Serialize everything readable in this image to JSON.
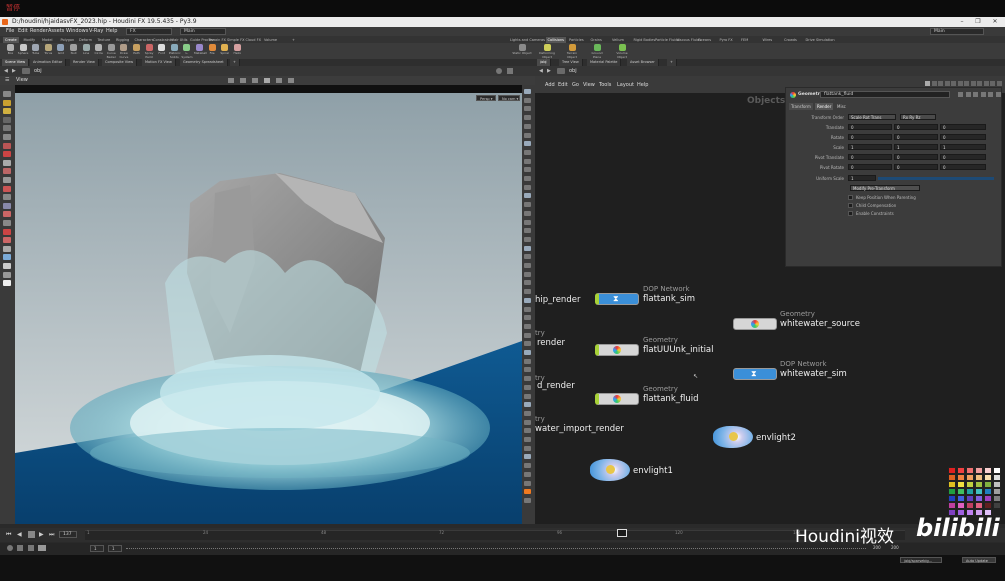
{
  "top_banner": "暂停",
  "window": {
    "title": "D:/houdini/hjaidasvFX_2023.hip - Houdini FX 19.5.435 - Py3.9",
    "controls": [
      "–",
      "❐",
      "✕"
    ]
  },
  "menubar": {
    "items": [
      "File",
      "Edit",
      "Render",
      "Assets",
      "Windows",
      "V-Ray",
      "Help"
    ],
    "fx_field": "FX",
    "main_field": "Main",
    "right_field": "Main"
  },
  "shelf_tabs_left": [
    "Create",
    "Modify",
    "Model",
    "Polygon",
    "Deform",
    "Texture",
    "Rigging",
    "Characters",
    "Constraints",
    "Hair Utils",
    "Guide Process",
    "Terrain FX",
    "Simple FX",
    "Cloud FX",
    "Volume"
  ],
  "shelf_tabs_right": [
    "Lights and Cameras",
    "Collisions",
    "Particles",
    "Grains",
    "Vellum",
    "Rigid Bodies",
    "Particle Fluids",
    "Viscous Fluids",
    "Oceans",
    "Pyro FX",
    "FEM",
    "Wires",
    "Crowds",
    "Drive Simulation"
  ],
  "shelf_tools_left": [
    "Box",
    "Sphere",
    "Tube",
    "Torus",
    "Grid",
    "Null",
    "Line",
    "Circle",
    "Curve Bezier",
    "Draw Curve",
    "Path",
    "Spray Paint",
    "Font",
    "Platonic Solids",
    "L-System",
    "Metaball",
    "File",
    "Spiral",
    "Helix"
  ],
  "shelf_tools_right": [
    "Static Object",
    "Deforming Object",
    "Terrain Object",
    "Ground Plane",
    "Volume Object"
  ],
  "panel_tabs_left": [
    "Scene View",
    "Animation Editor",
    "Render View",
    "Composite View",
    "Motion FX View",
    "Geometry Spreadsheet"
  ],
  "panel_tabs_right": [
    "/obj",
    "Tree View",
    "Material Palette",
    "Asset Browser"
  ],
  "path_left": "obj",
  "path_right": "obj",
  "viewport": {
    "label": "View",
    "persp_button": "Persp ▾",
    "cam_button": "No cam ▾"
  },
  "network": {
    "menu": [
      "Add",
      "Edit",
      "Go",
      "View",
      "Tools",
      "Layout",
      "Help"
    ],
    "context_label": "Objects",
    "nodes": [
      {
        "name": "flattank_sim",
        "type": "DOP Network",
        "kind": "dop",
        "flag": "green"
      },
      {
        "name": "flatUUUnk_initial",
        "type": "Geometry",
        "kind": "geo",
        "flag": "green"
      },
      {
        "name": "flattank_fluid",
        "type": "Geometry",
        "kind": "geo",
        "flag": "green"
      },
      {
        "name": "whitewater_source",
        "type": "Geometry",
        "kind": "geo",
        "flag": "none"
      },
      {
        "name": "whitewater_sim",
        "type": "DOP Network",
        "kind": "dop",
        "flag": "none"
      },
      {
        "name": "envlight2",
        "type": "",
        "kind": "light",
        "flag": "none"
      },
      {
        "name": "envlight1",
        "type": "",
        "kind": "light",
        "flag": "none"
      }
    ],
    "cut_labels": [
      "hip_render",
      "render",
      "d_render",
      "water_import_render"
    ],
    "cut_types": [
      "try",
      "try",
      "try"
    ]
  },
  "parameters": {
    "node_type": "Geometry",
    "node_name": "flattank_fluid",
    "tabs": [
      "Transform",
      "Render",
      "Misc"
    ],
    "transform_order_label": "Transform Order",
    "transform_order_value": "Scale Rot Trans",
    "rotate_order_value": "Rx Ry Rz",
    "rows": [
      {
        "label": "Translate",
        "values": [
          "0",
          "0",
          "0"
        ]
      },
      {
        "label": "Rotate",
        "values": [
          "0",
          "0",
          "0"
        ]
      },
      {
        "label": "Scale",
        "values": [
          "1",
          "1",
          "1"
        ]
      },
      {
        "label": "Pivot Translate",
        "values": [
          "0",
          "0",
          "0"
        ]
      },
      {
        "label": "Pivot Rotate",
        "values": [
          "0",
          "0",
          "0"
        ]
      }
    ],
    "uniform_scale_label": "Uniform Scale",
    "uniform_scale_value": "1",
    "modify_button": "Modify Pre-Transform",
    "checkboxes": [
      "Keep Position When Parenting",
      "Child Compensation",
      "Enable Constraints"
    ]
  },
  "timeline": {
    "current_frame": "137",
    "start_frame": "1",
    "start_frame2": "1",
    "end_frame": "200",
    "end_frame2": "200",
    "ticks": [
      "1",
      "24",
      "48",
      "72",
      "96",
      "120",
      "144",
      "168",
      "192"
    ],
    "status_path": "/obj/sparsebig...",
    "auto_update": "Auto Update"
  },
  "colors": {
    "dop_node": "#3b8fd8",
    "geo_node": "#d6d6d6",
    "display_flag": "#a8d238",
    "ocean": "#0d4f85",
    "viewport_sky": "#c8d0d3",
    "red_banner": "#cc3333"
  },
  "watermark": {
    "text": "Houdini视效",
    "logo": "bilibili"
  }
}
